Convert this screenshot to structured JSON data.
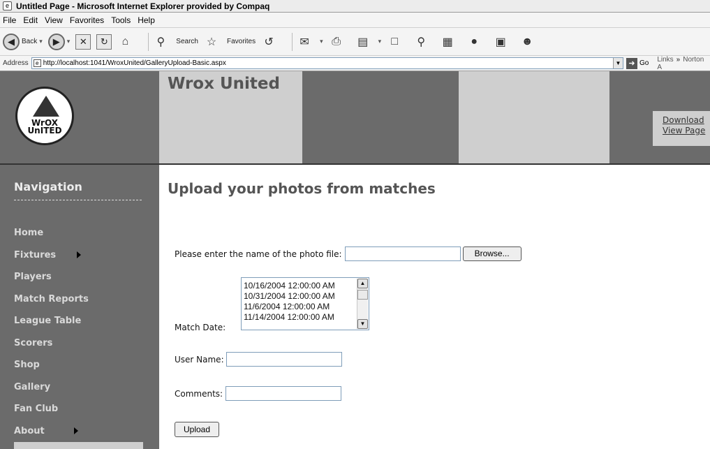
{
  "window": {
    "title": "Untitled Page - Microsoft Internet Explorer provided by Compaq"
  },
  "menubar": {
    "items": [
      "File",
      "Edit",
      "View",
      "Favorites",
      "Tools",
      "Help"
    ]
  },
  "toolbar": {
    "back_label": "Back",
    "search_label": "Search",
    "favorites_label": "Favorites"
  },
  "addressbar": {
    "label": "Address",
    "url": "http://localhost:1041/WroxUnited/GalleryUpload-Basic.aspx",
    "go_label": "Go",
    "links_label": "Links",
    "links_overflow": "Norton A"
  },
  "site": {
    "logo_text_line1": "WrOX",
    "logo_text_line2": "UnITED",
    "title": "Wrox United",
    "header_links": [
      "Download",
      "View Page"
    ]
  },
  "navigation": {
    "heading": "Navigation",
    "items": [
      {
        "label": "Home",
        "submenu": false
      },
      {
        "label": "Fixtures",
        "submenu": true
      },
      {
        "label": "Players",
        "submenu": false
      },
      {
        "label": "Match Reports",
        "submenu": false
      },
      {
        "label": "League Table",
        "submenu": false
      },
      {
        "label": "Scorers",
        "submenu": false
      },
      {
        "label": "Shop",
        "submenu": false
      },
      {
        "label": "Gallery",
        "submenu": false
      },
      {
        "label": "Fan Club",
        "submenu": false
      },
      {
        "label": "About",
        "submenu": true
      }
    ]
  },
  "form": {
    "heading": "Upload your photos from matches",
    "file_label": "Please enter the name of the photo file:",
    "file_value": "",
    "browse_label": "Browse...",
    "date_label": "Match Date:",
    "date_options": [
      "10/16/2004 12:00:00 AM",
      "10/31/2004 12:00:00 AM",
      "11/6/2004 12:00:00 AM",
      "11/14/2004 12:00:00 AM"
    ],
    "user_label": "User Name:",
    "user_value": "",
    "comments_label": "Comments:",
    "comments_value": "",
    "upload_label": "Upload"
  }
}
